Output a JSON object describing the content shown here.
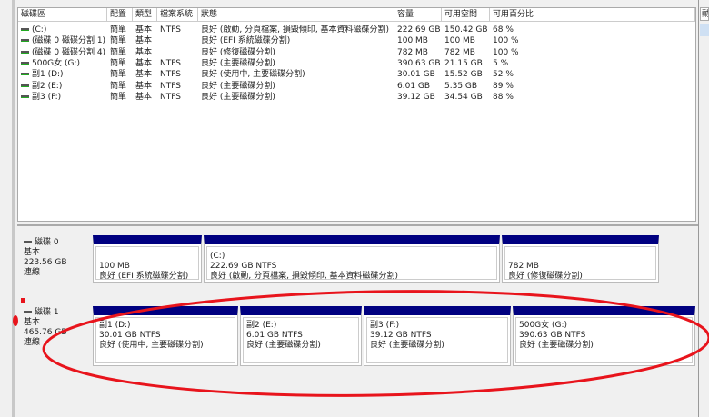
{
  "volume_table": {
    "headers": [
      "磁碟區",
      "配置",
      "類型",
      "檔案系統",
      "狀態",
      "容量",
      "可用空間",
      "可用百分比"
    ],
    "rows": [
      [
        "(C:)",
        "簡單",
        "基本",
        "NTFS",
        "良好 (啟動, 分頁檔案, 損毀傾印, 基本資料磁碟分割)",
        "222.69 GB",
        "150.42 GB",
        "68 %"
      ],
      [
        "(磁碟 0 磁碟分割 1)",
        "簡單",
        "基本",
        "",
        "良好 (EFI 系統磁碟分割)",
        "100 MB",
        "100 MB",
        "100 %"
      ],
      [
        "(磁碟 0 磁碟分割 4)",
        "簡單",
        "基本",
        "",
        "良好 (修復磁碟分割)",
        "782 MB",
        "782 MB",
        "100 %"
      ],
      [
        "500G女 (G:)",
        "簡單",
        "基本",
        "NTFS",
        "良好 (主要磁碟分割)",
        "390.63 GB",
        "21.15 GB",
        "5 %"
      ],
      [
        "副1 (D:)",
        "簡單",
        "基本",
        "NTFS",
        "良好 (使用中, 主要磁碟分割)",
        "30.01 GB",
        "15.52 GB",
        "52 %"
      ],
      [
        "副2 (E:)",
        "簡單",
        "基本",
        "NTFS",
        "良好 (主要磁碟分割)",
        "6.01 GB",
        "5.35 GB",
        "89 %"
      ],
      [
        "副3 (F:)",
        "簡單",
        "基本",
        "NTFS",
        "良好 (主要磁碟分割)",
        "39.12 GB",
        "34.54 GB",
        "88 %"
      ]
    ]
  },
  "disks": [
    {
      "name": "磁碟 0",
      "type": "基本",
      "size": "223.56 GB",
      "status": "連線",
      "partitions": [
        {
          "title": "",
          "size": "100 MB",
          "status": "良好 (EFI 系統磁碟分割)"
        },
        {
          "title": "(C:)",
          "size": "222.69 GB NTFS",
          "status": "良好 (啟動, 分頁檔案, 損毀傾印, 基本資料磁碟分割)"
        },
        {
          "title": "",
          "size": "782 MB",
          "status": "良好 (修復磁碟分割)"
        }
      ]
    },
    {
      "name": "磁碟 1",
      "type": "基本",
      "size": "465.76 GB",
      "status": "連線",
      "partitions": [
        {
          "title": "副1  (D:)",
          "size": "30.01 GB NTFS",
          "status": "良好 (使用中, 主要磁碟分割)"
        },
        {
          "title": "副2  (E:)",
          "size": "6.01 GB NTFS",
          "status": "良好 (主要磁碟分割)"
        },
        {
          "title": "副3  (F:)",
          "size": "39.12 GB NTFS",
          "status": "良好 (主要磁碟分割)"
        },
        {
          "title": "500G女  (G:)",
          "size": "390.63 GB NTFS",
          "status": "良好 (主要磁碟分割)"
        }
      ]
    }
  ],
  "right_panel": {
    "header": "動"
  },
  "colors": {
    "partition_bar": "#000080",
    "annotation": "#e8141c"
  }
}
